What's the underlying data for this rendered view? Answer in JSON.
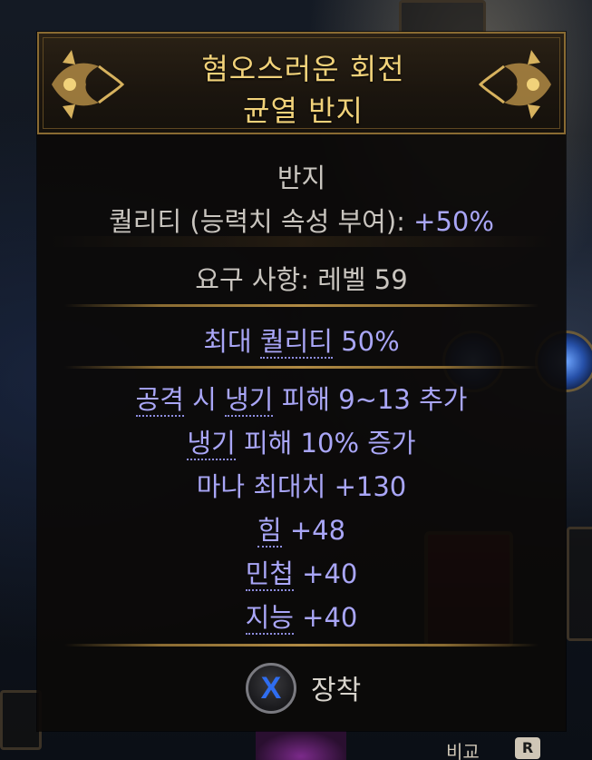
{
  "item": {
    "name_line1": "혐오스러운 회전",
    "name_line2": "균열 반지",
    "type": "반지",
    "quality_label": "퀄리티 (능력치 속성 부여):",
    "quality_value": "+50%",
    "requirements": "요구 사항: 레벨 59",
    "max_quality": {
      "word1": "최대",
      "word2": "퀄리티",
      "rest": "50%"
    },
    "mods": [
      {
        "pre": "",
        "term": "공격",
        "mid": " 시 ",
        "term2": "냉기",
        "post": " 피해 9~13 추가"
      },
      {
        "pre": "",
        "term": "냉기",
        "mid": " 피해 10% 증가",
        "term2": "",
        "post": ""
      },
      {
        "pre": "마나 최대치 +130",
        "term": "",
        "mid": "",
        "term2": "",
        "post": ""
      },
      {
        "pre": "",
        "term": "힘",
        "mid": " +48",
        "term2": "",
        "post": ""
      },
      {
        "pre": "",
        "term": "민첩",
        "mid": " +40",
        "term2": "",
        "post": ""
      },
      {
        "pre": "",
        "term": "지능",
        "mid": " +40",
        "term2": "",
        "post": ""
      }
    ]
  },
  "action": {
    "button_glyph": "X",
    "label": "장착"
  },
  "background": {
    "tab_label": "비교",
    "tab_key": "R"
  },
  "colors": {
    "title": "#f1d27a",
    "mod_text": "#a9a6f7",
    "base_text": "#c9c5bf",
    "frame_gold": "#8a6b32"
  }
}
